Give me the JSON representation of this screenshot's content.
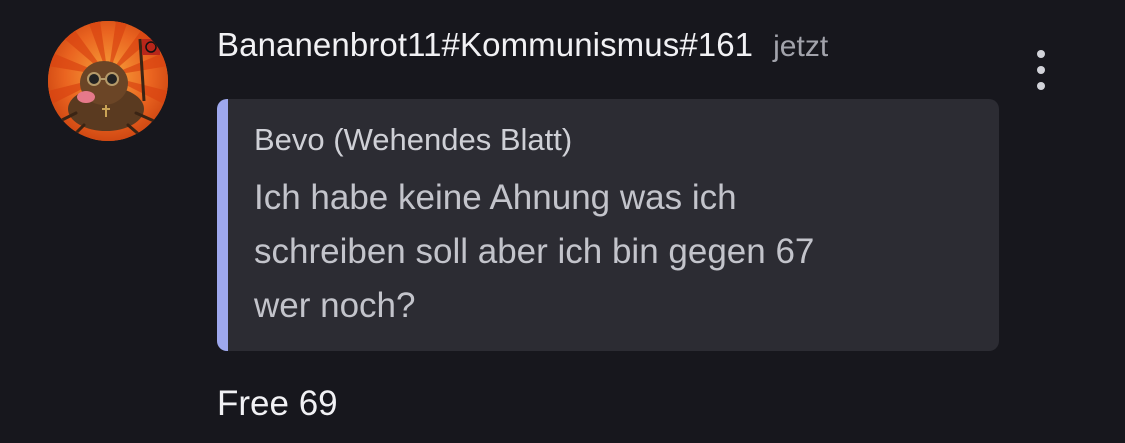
{
  "message": {
    "author": "Bananenbrot11#Kommunismus#161",
    "timestamp": "jetzt",
    "quote": {
      "author": "Bevo (Wehendes Blatt)",
      "lines": [
        "Ich habe keine Ahnung was ich",
        "schreiben soll aber ich bin gegen 67",
        "wer noch?"
      ]
    },
    "body": "Free 69"
  },
  "icons": {
    "more": "vertical-ellipsis-icon",
    "avatar": "user-avatar"
  },
  "colors": {
    "background": "#17171d",
    "quote_background": "#2c2c33",
    "quote_accent": "#9ea8ee",
    "text_primary": "#f1f1f4",
    "text_muted": "#a2a3ab",
    "avatar_orange": "#e8591b"
  }
}
